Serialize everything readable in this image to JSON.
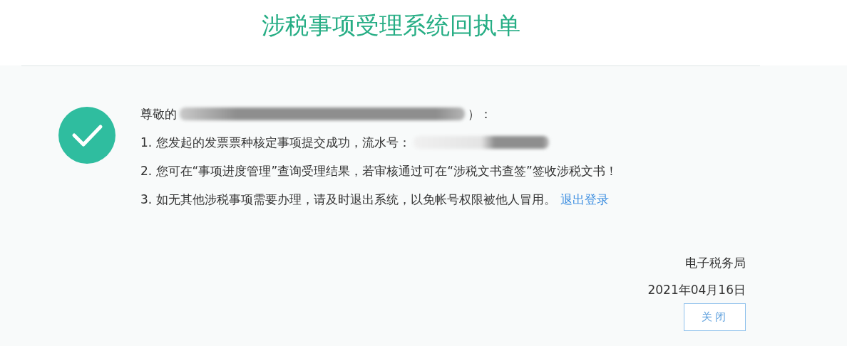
{
  "title": "涉税事项受理系统回执单",
  "greeting": {
    "prefix": "尊敬的",
    "suffix": "）："
  },
  "lines": [
    {
      "text": "1. 您发起的发票票种核定事项提交成功，流水号：",
      "redacted": true
    },
    {
      "text": "2. 您可在“事项进度管理”查询受理结果，若审核通过可在“涉税文书查签”签收涉税文书！",
      "redacted": false
    },
    {
      "text": "3. 如无其他涉税事项需要办理，请及时退出系统，以免帐号权限被他人冒用。",
      "redacted": false,
      "link": "退出登录"
    }
  ],
  "signature": "电子税务局",
  "date": "2021年04月16日",
  "close_button": "关闭"
}
